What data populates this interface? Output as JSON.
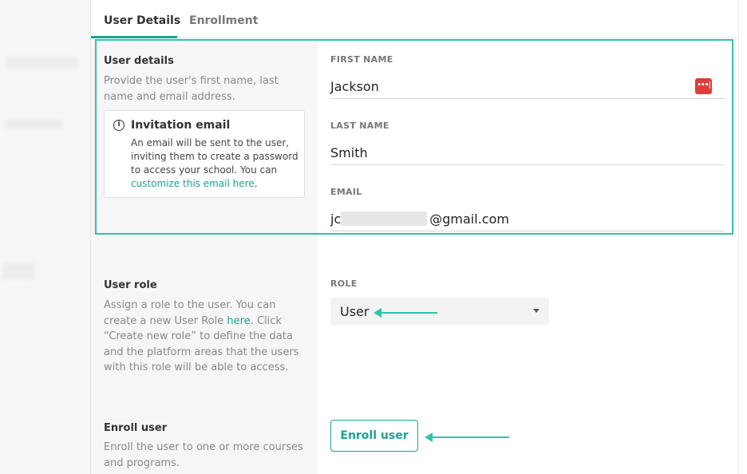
{
  "tabs": [
    {
      "label": "User Details",
      "active": true
    },
    {
      "label": "Enrollment",
      "active": false
    }
  ],
  "user_details": {
    "title": "User details",
    "description": "Provide the user's first name, last name and email address.",
    "invitation": {
      "title": "Invitation email",
      "text": "An email will be sent to the user, inviting them to create a password to access your school. You can ",
      "link": "customize this email here",
      "suffix": "."
    }
  },
  "fields": {
    "first_name": {
      "label": "FIRST NAME",
      "value": "Jackson"
    },
    "last_name": {
      "label": "LAST NAME",
      "value": "Smith"
    },
    "email": {
      "label": "EMAIL",
      "value_prefix": "jc",
      "value_suffix": "@gmail.com"
    }
  },
  "user_role": {
    "title": "User role",
    "desc_part1": "Assign a role to the user. You can create a new User Role ",
    "desc_link": "here",
    "desc_part2": ". Click “Create new role” to define the data and the platform areas that the users with this role will be able to access.",
    "role_label": "ROLE",
    "role_value": "User"
  },
  "enroll": {
    "title": "Enroll user",
    "description": "Enroll the user to one or more courses and programs.",
    "button_label": "Enroll user"
  },
  "password_manager_icon": "•••|",
  "colors": {
    "accent": "#1aa392",
    "highlight": "#2dc4a9",
    "password_icon": "#e03c3c"
  }
}
